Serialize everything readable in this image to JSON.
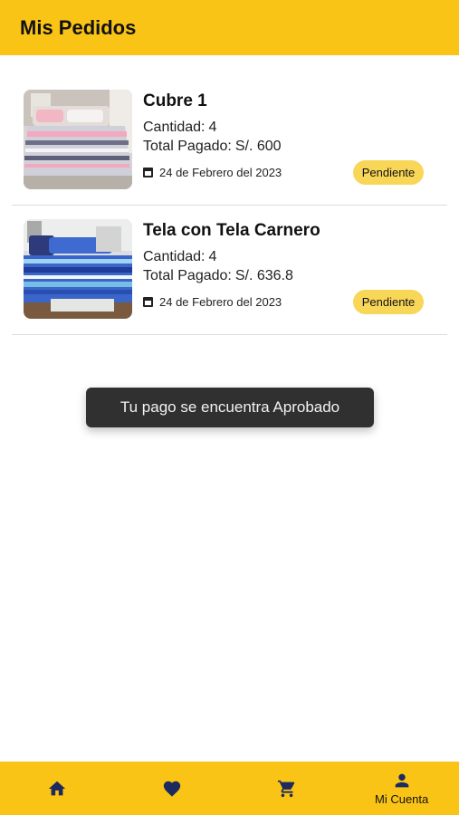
{
  "header": {
    "title": "Mis Pedidos"
  },
  "orders": [
    {
      "name": "Cubre 1",
      "quantity_label": "Cantidad:",
      "quantity": "4",
      "total_label": "Total Pagado:",
      "total": "S/. 600",
      "date": "24 de Febrero del 2023",
      "status": "Pendiente",
      "image_icon": "bedding-grey-pink-striped"
    },
    {
      "name": "Tela con Tela Carnero",
      "quantity_label": "Cantidad:",
      "quantity": "4",
      "total_label": "Total Pagado:",
      "total": "S/. 636.8",
      "date": "24 de Febrero del 2023",
      "status": "Pendiente",
      "image_icon": "bedding-blue-striped"
    }
  ],
  "toast": {
    "message": "Tu pago se encuentra Aprobado"
  },
  "bottom_nav": {
    "items": [
      {
        "icon": "home-icon",
        "label": ""
      },
      {
        "icon": "heart-icon",
        "label": ""
      },
      {
        "icon": "cart-icon",
        "label": ""
      },
      {
        "icon": "person-icon",
        "label": "Mi Cuenta"
      }
    ]
  },
  "colors": {
    "primary": "#fac416",
    "badge": "#f8d658",
    "nav_icon": "#1d2a5e",
    "toast_bg": "#303030"
  }
}
